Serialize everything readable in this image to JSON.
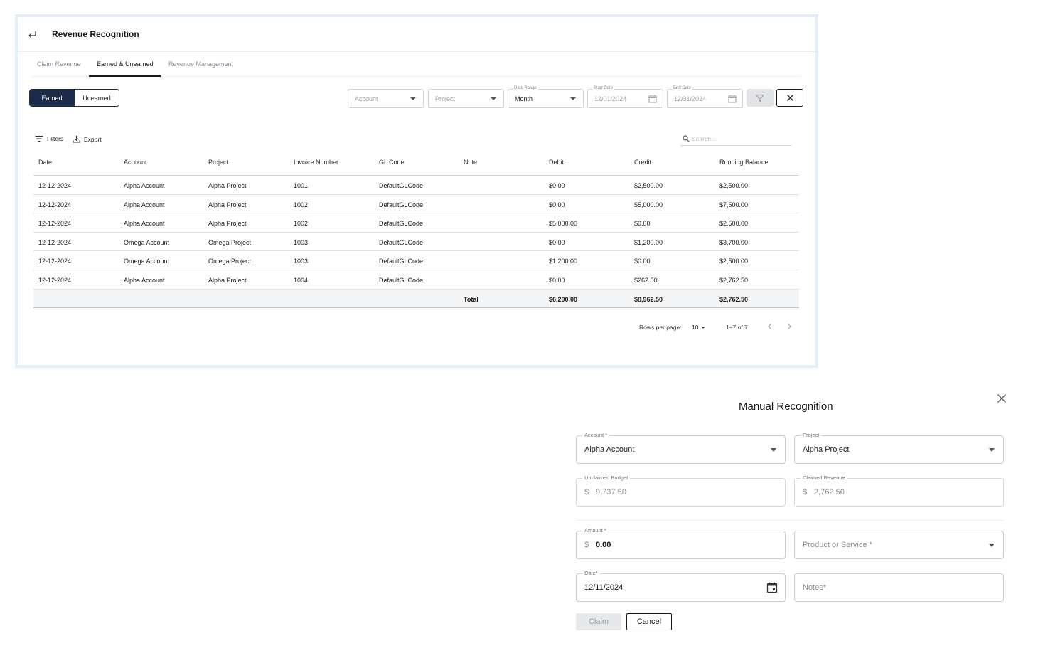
{
  "page": {
    "title": "Revenue Recognition",
    "tabs": [
      {
        "label": "Claim Revenue"
      },
      {
        "label": "Earned & Unearned"
      },
      {
        "label": "Revenue Management"
      }
    ],
    "active_tab": "Earned & Unearned"
  },
  "toggle": {
    "earned": "Earned",
    "unearned": "Unearned",
    "selected": "Earned"
  },
  "filters": {
    "account_placeholder": "Account",
    "project_placeholder": "Project",
    "date_range_label": "Date Range",
    "date_range_value": "Month",
    "start_date_label": "Start Date",
    "start_date_value": "12/01/2024",
    "end_date_label": "End Date",
    "end_date_value": "12/31/2024"
  },
  "toolbar": {
    "filters_label": "Filters",
    "export_label": "Export",
    "search_placeholder": "Search..."
  },
  "table": {
    "columns": [
      "Date",
      "Account",
      "Project",
      "Invoice Number",
      "GL Code",
      "Note",
      "Debit",
      "Credit",
      "Running Balance"
    ],
    "rows": [
      [
        "12-12-2024",
        "Alpha Account",
        "Alpha Project",
        "1001",
        "DefaultGLCode",
        "",
        "$0.00",
        "$2,500.00",
        "$2,500.00"
      ],
      [
        "12-12-2024",
        "Alpha Account",
        "Alpha Project",
        "1002",
        "DefaultGLCode",
        "",
        "$0.00",
        "$5,000.00",
        "$7,500.00"
      ],
      [
        "12-12-2024",
        "Alpha Account",
        "Alpha Project",
        "1002",
        "DefaultGLCode",
        "",
        "$5,000.00",
        "$0.00",
        "$2,500.00"
      ],
      [
        "12-12-2024",
        "Omega Account",
        "Omega Project",
        "1003",
        "DefaultGLCode",
        "",
        "$0.00",
        "$1,200.00",
        "$3,700.00"
      ],
      [
        "12-12-2024",
        "Omega Account",
        "Omega Project",
        "1003",
        "DefaultGLCode",
        "",
        "$1,200.00",
        "$0.00",
        "$2,500.00"
      ],
      [
        "12-12-2024",
        "Alpha Account",
        "Alpha Project",
        "1004",
        "DefaultGLCode",
        "",
        "$0.00",
        "$262.50",
        "$2,762.50"
      ]
    ],
    "total": {
      "label": "Total",
      "debit": "$6,200.00",
      "credit": "$8,962.50",
      "balance": "$2,762.50"
    }
  },
  "pagination": {
    "rows_per_page_label": "Rows per page:",
    "rows_per_page_value": "10",
    "range_text": "1–7 of 7"
  },
  "modal": {
    "title": "Manual Recognition",
    "account_label": "Account *",
    "account_value": "Alpha Account",
    "project_label": "Project",
    "project_value": "Alpha Project",
    "unclaimed_label": "Unclaimed Budget",
    "unclaimed_currency": "$",
    "unclaimed_value": "9,737.50",
    "claimed_label": "Claimed Revenue",
    "claimed_currency": "$",
    "claimed_value": "2,762.50",
    "amount_label": "Amount *",
    "amount_currency": "$",
    "amount_value": "0.00",
    "product_placeholder": "Product or Service *",
    "date_label": "Date*",
    "date_value": "12/11/2024",
    "notes_placeholder": "Notes*",
    "claim_label": "Claim",
    "cancel_label": "Cancel"
  },
  "colors": {
    "primary_navy": "#1d2b4a",
    "panel_border": "#e4eef8",
    "total_row_bg": "#f4f5f6"
  }
}
